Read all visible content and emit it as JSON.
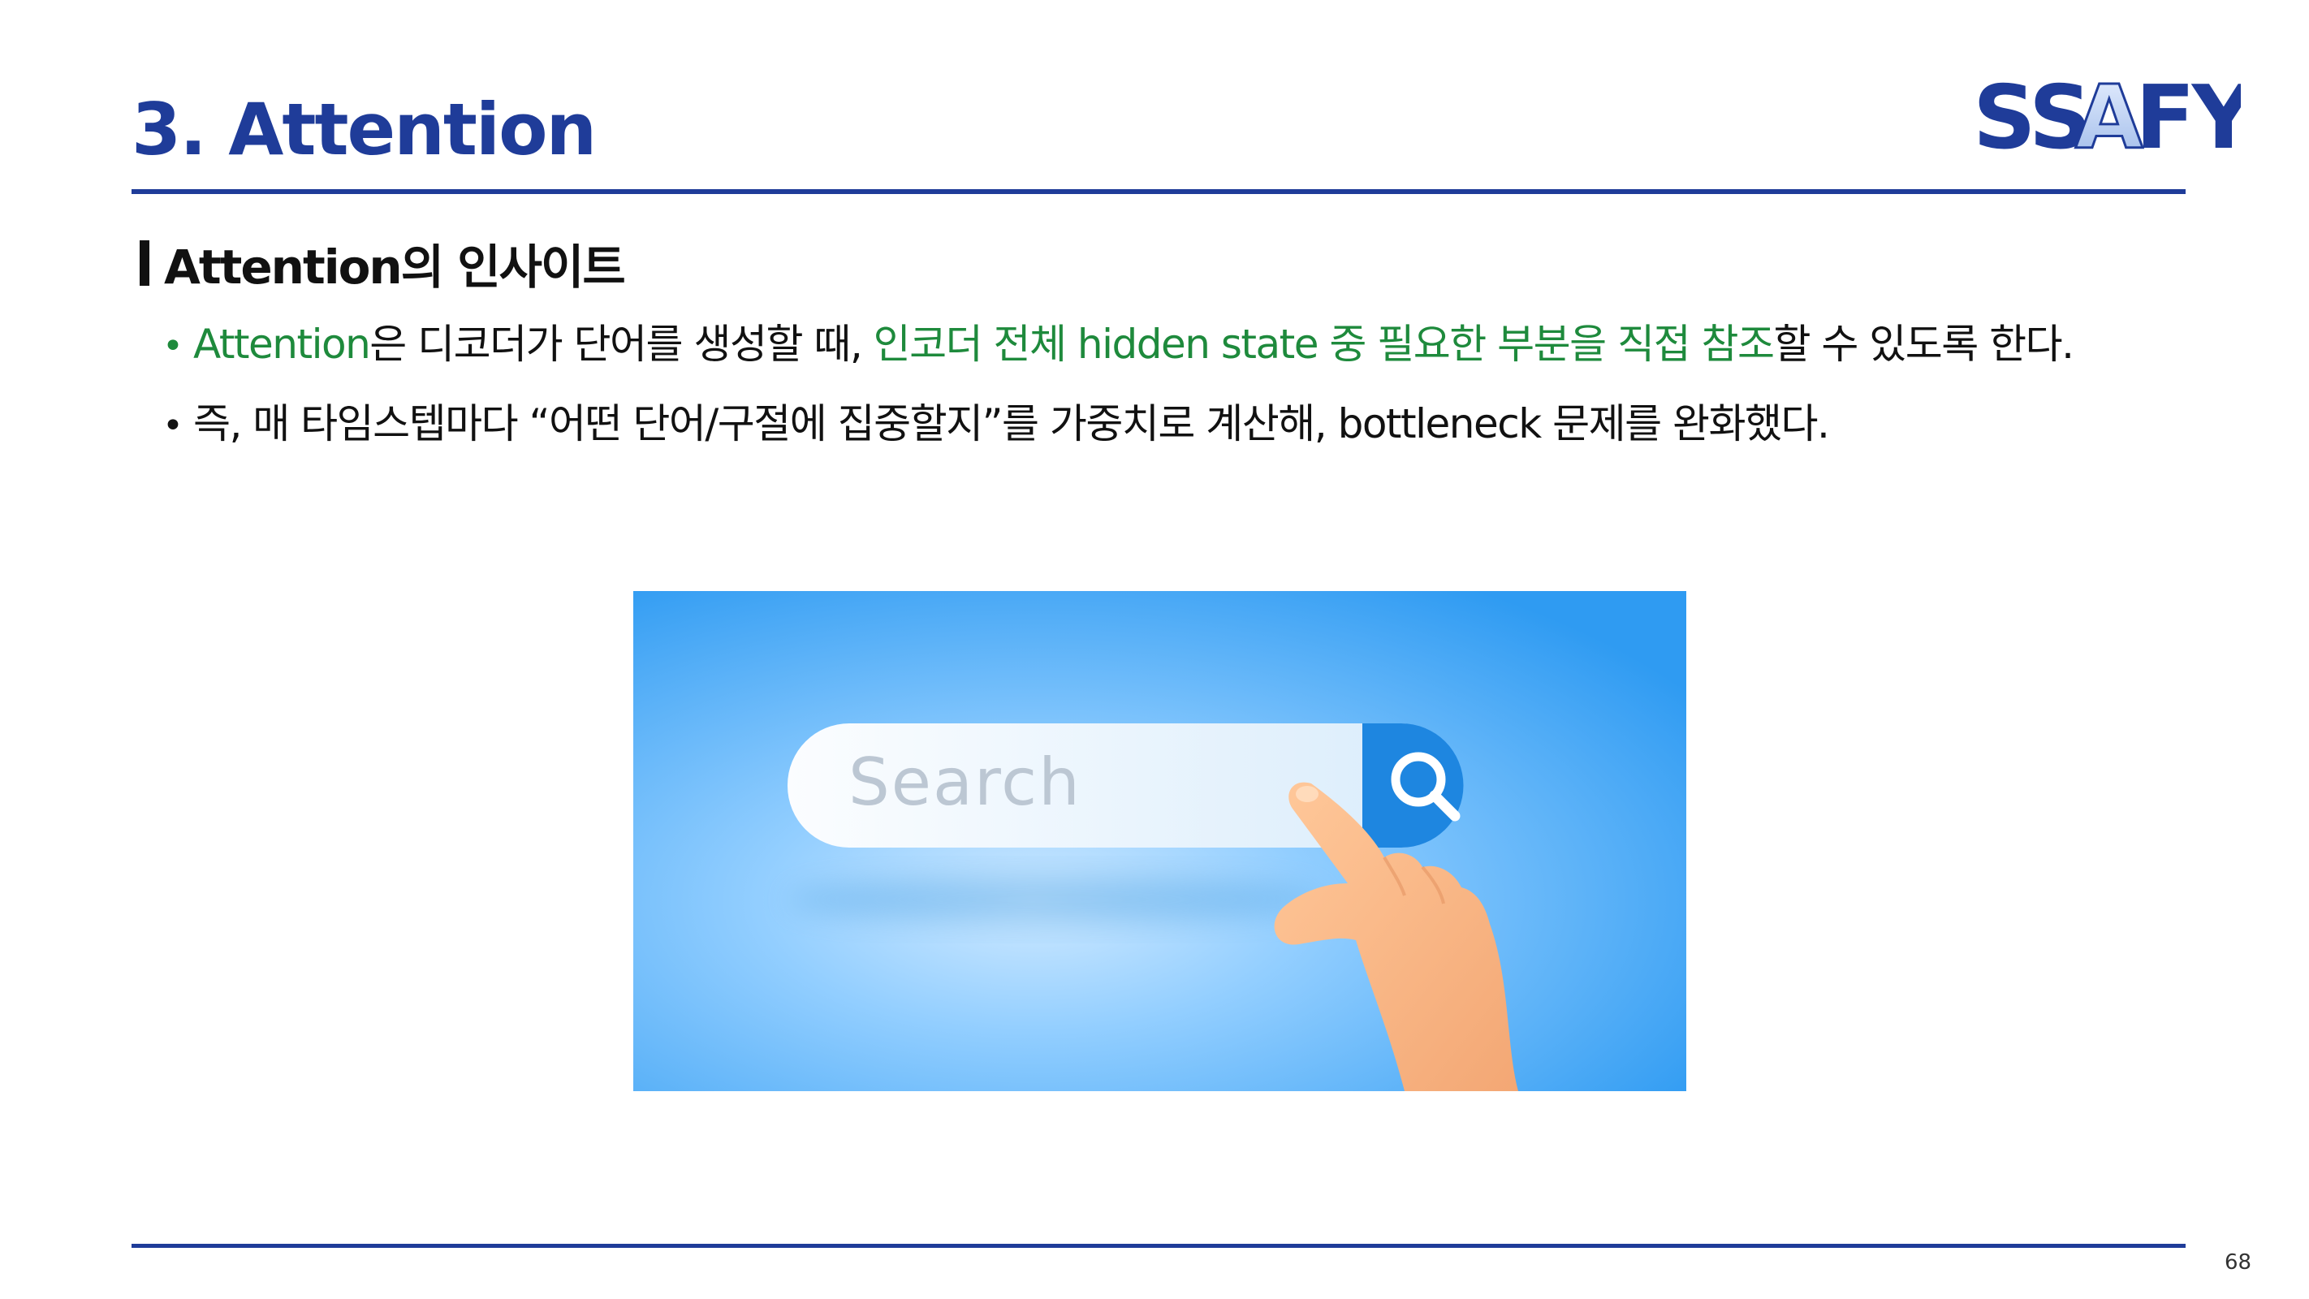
{
  "slide": {
    "title": "3. Attention",
    "logo_text": "SSAFY",
    "section_heading": "Attention의 인사이트",
    "bullets": [
      {
        "dot": "•",
        "highlight1": "Attention",
        "text1": "은 디코더가 단어를 생성할 때, ",
        "highlight2": "인코더 전체 hidden state 중 필요한 부분을 직접 참조",
        "text2": "할 수 있도록 한다."
      },
      {
        "dot": "•",
        "text": "즉, 매 타임스텝마다 “어떤 단어/구절에 집중할지”를 가중치로 계산해, bottleneck 문제를 완화했다."
      }
    ],
    "illustration": {
      "search_placeholder": "Search",
      "search_icon": "magnifier-icon",
      "hand_icon": "pointing-hand-icon"
    },
    "page_number": "68"
  },
  "colors": {
    "title_blue": "#1f3c99",
    "highlight_green": "#1e8a3c",
    "rule_blue": "#1f3c99",
    "search_button_blue": "#1e86e0",
    "background_blue": "#56b0f2"
  }
}
